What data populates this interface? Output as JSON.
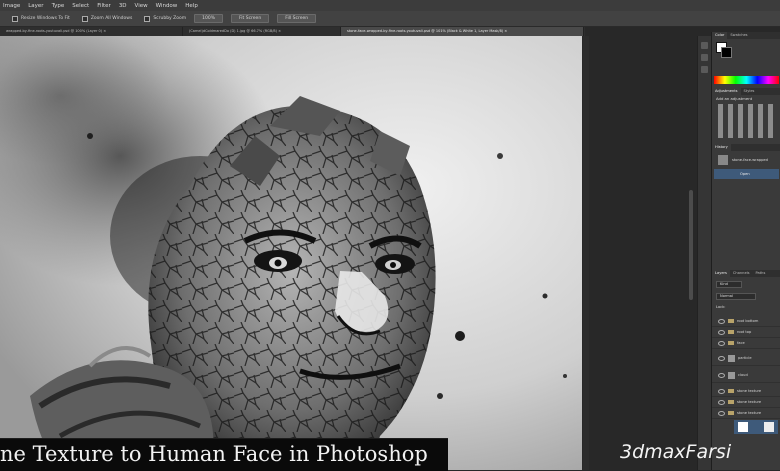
{
  "menu": [
    "Image",
    "Layer",
    "Type",
    "Select",
    "Filter",
    "3D",
    "View",
    "Window",
    "Help"
  ],
  "options": {
    "resize_windows_to_fit": "Resize Windows To Fit",
    "zoom_all_windows": "Zoom All Windows",
    "scrubby_zoom": "Scrubby Zoom",
    "zoom_percent": "100%",
    "fit_screen": "Fit Screen",
    "fill_screen": "Fill Screen"
  },
  "tabs": [
    "wrapped-by-fine-roots-youtuvali.psd @ 100% (Layer 0) ×",
    "(Camel)dColdmaredDo (D) 1.jpg @ 66.7% (RGB/8) ×",
    "stone-face-wrapped-by-fine-roots-youtuvali.psd @ 101% (Black & White 1, Layer Mask/8) ×"
  ],
  "panels": {
    "color_tabs": [
      "Color",
      "Swatches"
    ],
    "adjust_tabs": [
      "Adjustments",
      "Styles"
    ],
    "adjust_label": "Add an adjustment",
    "history_tab": "History",
    "history_items": [
      "stone-face-wrapped",
      "Open"
    ],
    "layers_tabs": [
      "Layers",
      "Channels",
      "Paths"
    ],
    "kind": "Kind",
    "blend": "Normal",
    "lock": "Lock:",
    "layers": [
      "root bottom",
      "root top",
      "face",
      "particle",
      "cloud",
      "stone texture",
      "stone texture",
      "stone texture"
    ]
  },
  "title_text": "ne Texture to Human Face in Photoshop",
  "watermark": "3dmaxFarsi",
  "colors": {
    "menubar": "#3c3c3c",
    "panel": "#3a3a3a",
    "canvas_bg": "#282828"
  }
}
